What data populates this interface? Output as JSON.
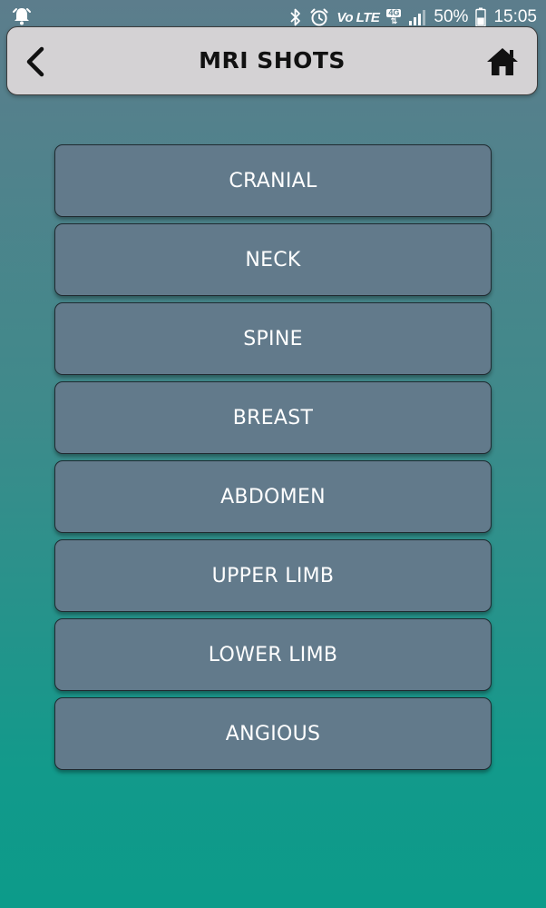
{
  "status_bar": {
    "network_label": "Vo LTE",
    "network_badge": "4G",
    "battery_percent": "50%",
    "time": "15:05",
    "icons": [
      "alarm-bell-icon",
      "bluetooth-icon",
      "alarm-clock-icon",
      "signal-icon",
      "battery-icon"
    ]
  },
  "header": {
    "title": "MRI SHOTS",
    "back_icon": "chevron-left-icon",
    "home_icon": "home-icon"
  },
  "menu": {
    "items": [
      {
        "label": "CRANIAL"
      },
      {
        "label": "NECK"
      },
      {
        "label": "SPINE"
      },
      {
        "label": "BREAST"
      },
      {
        "label": "ABDOMEN"
      },
      {
        "label": "UPPER LIMB"
      },
      {
        "label": "LOWER LIMB"
      },
      {
        "label": "ANGIOUS"
      }
    ]
  },
  "colors": {
    "button_fill": "#627a8b",
    "header_fill": "#d4d2d4",
    "background_top": "#5c7d8c",
    "background_bottom": "#0c9b8a"
  }
}
